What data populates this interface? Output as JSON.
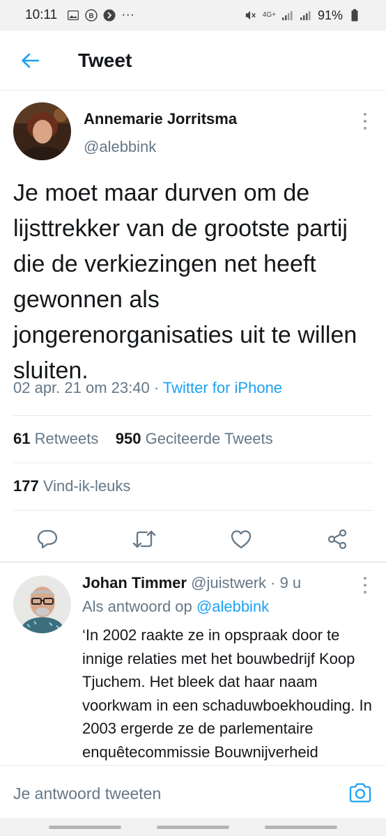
{
  "status_bar": {
    "time": "10:11",
    "network": "4G+",
    "battery": "91%",
    "more": "···"
  },
  "header": {
    "title": "Tweet"
  },
  "tweet": {
    "author_name": "Annemarie Jorritsma",
    "author_handle": "@alebbink",
    "text": "Je moet maar durven om de lijsttrekker van de grootste partij die de verkiezingen net heeft gewonnen als jongerenorganisaties uit te willen sluiten.",
    "timestamp": "02 apr. 21 om 23:40",
    "separator": " · ",
    "source": "Twitter for iPhone",
    "retweets_count": "61",
    "retweets_label": "Retweets",
    "quotes_count": "950",
    "quotes_label": "Geciteerde Tweets",
    "likes_count": "177",
    "likes_label": "Vind-ik-leuks"
  },
  "reply": {
    "author_name": "Johan Timmer",
    "author_handle": "@juistwerk",
    "time": "· 9 u",
    "reply_prefix": "Als antwoord op",
    "reply_to": "@alebbink",
    "text": "‘In 2002 raakte ze in opspraak door te innige relaties met het bouwbedrijf Koop Tjuchem. Het bleek dat haar naam voorkwam in een schaduwboekhouding. In 2003 ergerde ze de parlementaire enquêtecommissie Bouwnijverheid"
  },
  "compose": {
    "placeholder": "Je antwoord tweeten"
  },
  "colors": {
    "accent": "#1da1f2",
    "secondary_text": "#657786",
    "divider": "#e6ecf0"
  },
  "icons": [
    "back-arrow-icon",
    "more-vertical-icon",
    "reply-icon",
    "retweet-icon",
    "like-icon",
    "share-icon",
    "camera-icon"
  ]
}
